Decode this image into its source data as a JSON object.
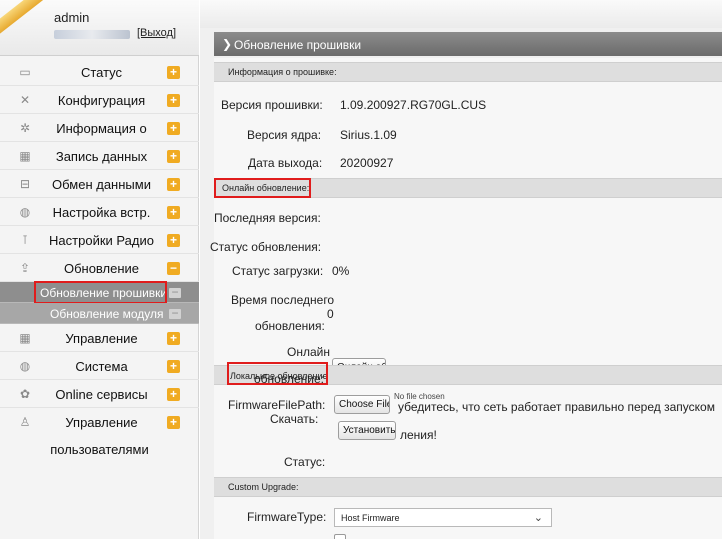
{
  "user": {
    "name": "admin",
    "logout": "[Выход]"
  },
  "sidebar": {
    "items": [
      {
        "label": "Статус",
        "icon": "monitor-icon",
        "glyph": "▭"
      },
      {
        "label": "Конфигурация",
        "icon": "tools-icon",
        "glyph": "✕"
      },
      {
        "label": "Информация о",
        "icon": "info-icon",
        "glyph": "✲"
      },
      {
        "label": "Запись данных",
        "icon": "calendar-icon",
        "glyph": "▦"
      },
      {
        "label": "Обмен данными",
        "icon": "exchange-icon",
        "glyph": "⊟"
      },
      {
        "label": "Настройка встр.",
        "icon": "globe-icon",
        "glyph": "◍"
      },
      {
        "label": "Настройки Радио",
        "icon": "antenna-icon",
        "glyph": "⊺"
      },
      {
        "label": "Обновление",
        "icon": "upgrade-icon",
        "glyph": "⇪"
      }
    ],
    "sub_items": [
      {
        "label": "Обновление прошивки"
      },
      {
        "label": "Обновление модуля"
      }
    ],
    "items_after": [
      {
        "label": "Управление",
        "icon": "calendar-icon",
        "glyph": "▦"
      },
      {
        "label": "Система",
        "icon": "globe-icon",
        "glyph": "◍"
      },
      {
        "label": "Online сервисы",
        "icon": "gear-icon",
        "glyph": "✿"
      },
      {
        "label": "Управление",
        "icon": "user-icon",
        "glyph": "♙"
      }
    ],
    "extra_label": "пользователями",
    "plus_symbol": "+",
    "minus_symbol": "−"
  },
  "header": {
    "title": "Обновление прошивки",
    "chevron": "❯"
  },
  "firmware_info": {
    "title": "Информация о прошивке:",
    "rows": [
      {
        "label": "Версия прошивки:",
        "value": "1.09.200927.RG70GL.CUS"
      },
      {
        "label": "Версия ядра:",
        "value": "Sirius.1.09"
      },
      {
        "label": "Дата выхода:",
        "value": "20200927"
      }
    ]
  },
  "online_update": {
    "title": "Онлайн обновление:",
    "latest_label": "Последняя версия:",
    "status_label": "Статус обновления:",
    "download_label": "Статус загрузки:",
    "download_value": "0%",
    "last_time_label_1": "Время последнего",
    "last_time_label_2": "обновления:",
    "last_time_value": "0",
    "online_label_1": "Онлайн",
    "online_label_2": "обновление:",
    "online_button": "Онлайн обн"
  },
  "local_update": {
    "title": "Локальное обновление",
    "file_path_label": "FirmwareFilePath:",
    "choose_file": "Choose File",
    "no_file": "No file chosen",
    "warning_text": "убедитесь, что сеть работает правильно перед запуском",
    "download_label": "Скачать:",
    "install_button": "Установить",
    "warning_tail": "ления!",
    "status_label": "Статус:"
  },
  "custom_upgrade": {
    "title": "Custom Upgrade:",
    "type_label": "FirmwareType:",
    "type_value": "Host Firmware",
    "caret": "⌄"
  },
  "colors": {
    "accent": "#f0ab22",
    "highlight": "#e01c1c",
    "header_bg": "#7a7a7a",
    "section_bg": "#dedede"
  }
}
